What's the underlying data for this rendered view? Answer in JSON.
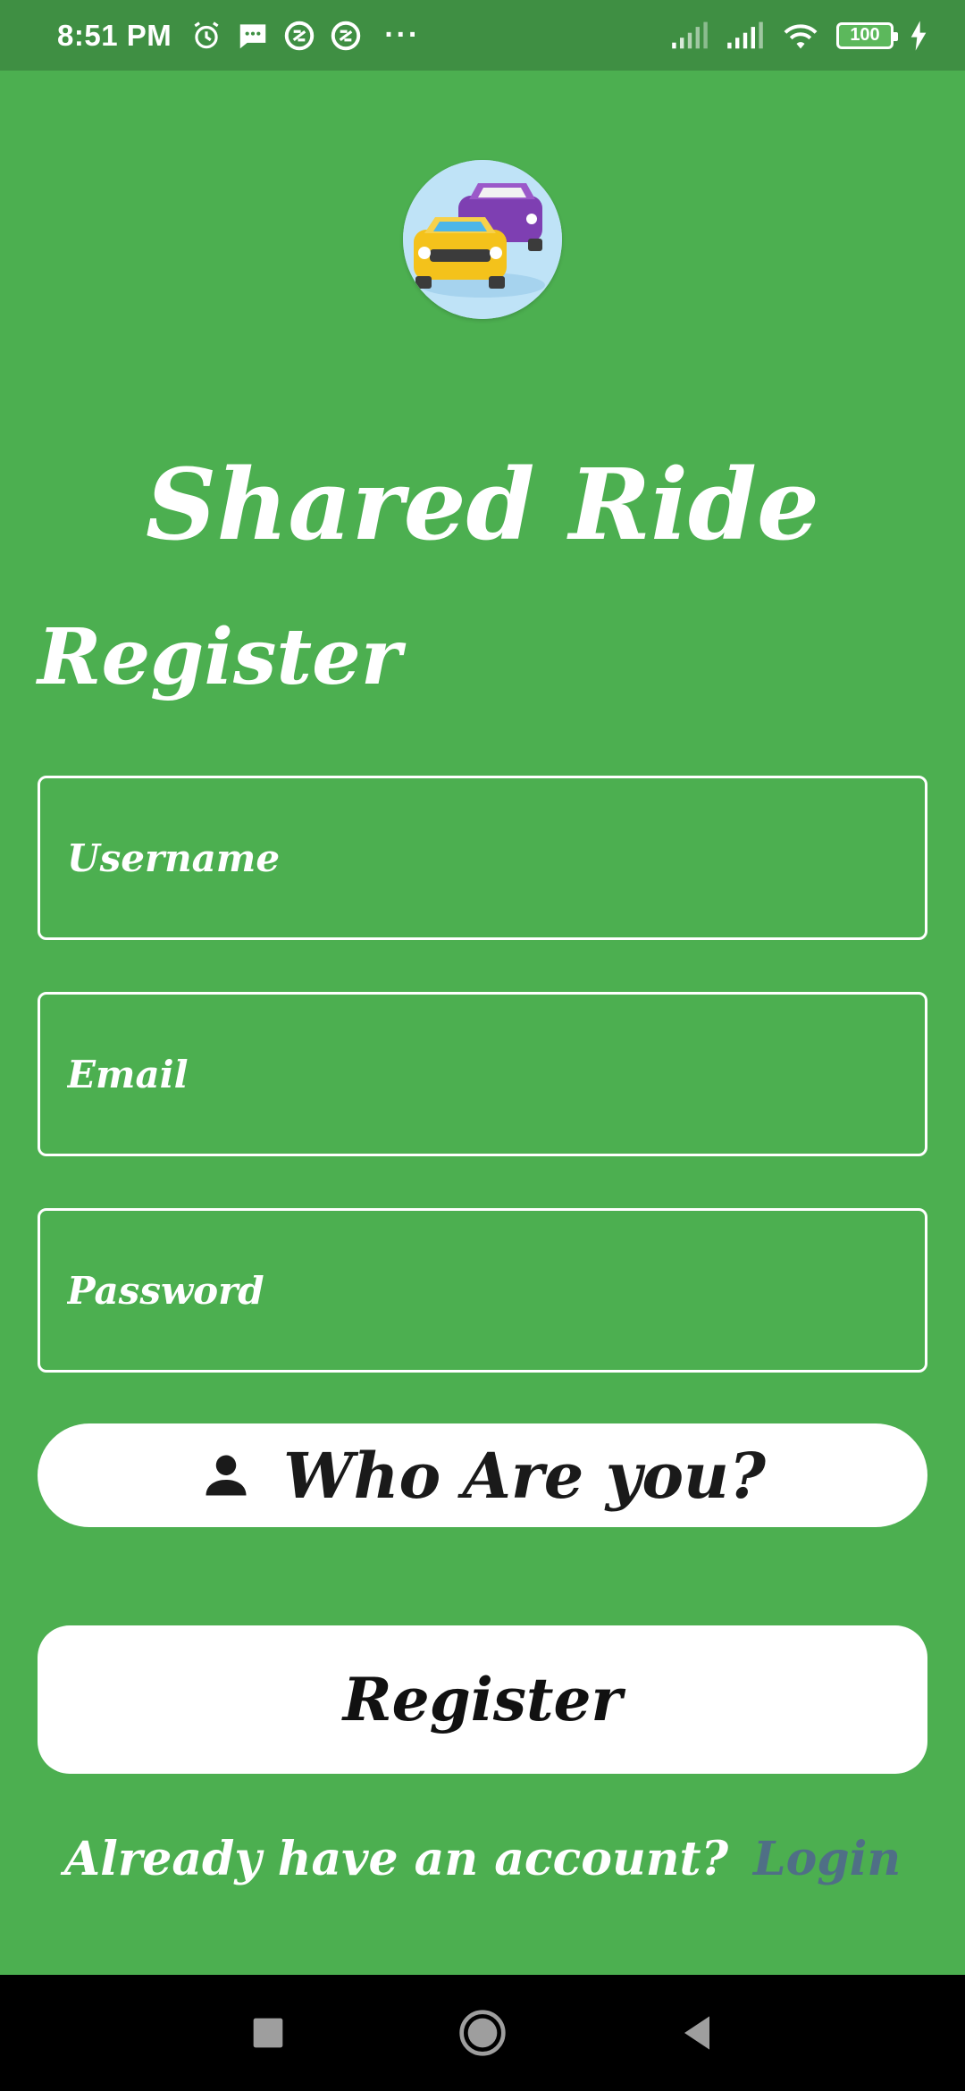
{
  "status_bar": {
    "time": "8:51 PM",
    "left_icons": [
      "alarm-icon",
      "message-icon",
      "sync-icon",
      "sync-icon"
    ],
    "overflow": "···",
    "battery": "100"
  },
  "app": {
    "logo": "cars-logo",
    "title": "Shared Ride"
  },
  "form": {
    "heading": "Register",
    "username_placeholder": "Username",
    "email_placeholder": "Email",
    "password_placeholder": "Password",
    "role_label": "Who Are you?",
    "role_icon": "person-icon",
    "submit_label": "Register"
  },
  "footer": {
    "prompt": "Already have an account?",
    "login_link": "Login"
  },
  "nav_bar": {
    "buttons": [
      "recents-square-icon",
      "home-circle-icon",
      "back-triangle-icon"
    ]
  },
  "colors": {
    "background": "#4caf50",
    "status_bar": "#3f8f43",
    "login_link": "#4f6f86",
    "button_bg": "#ffffff"
  }
}
